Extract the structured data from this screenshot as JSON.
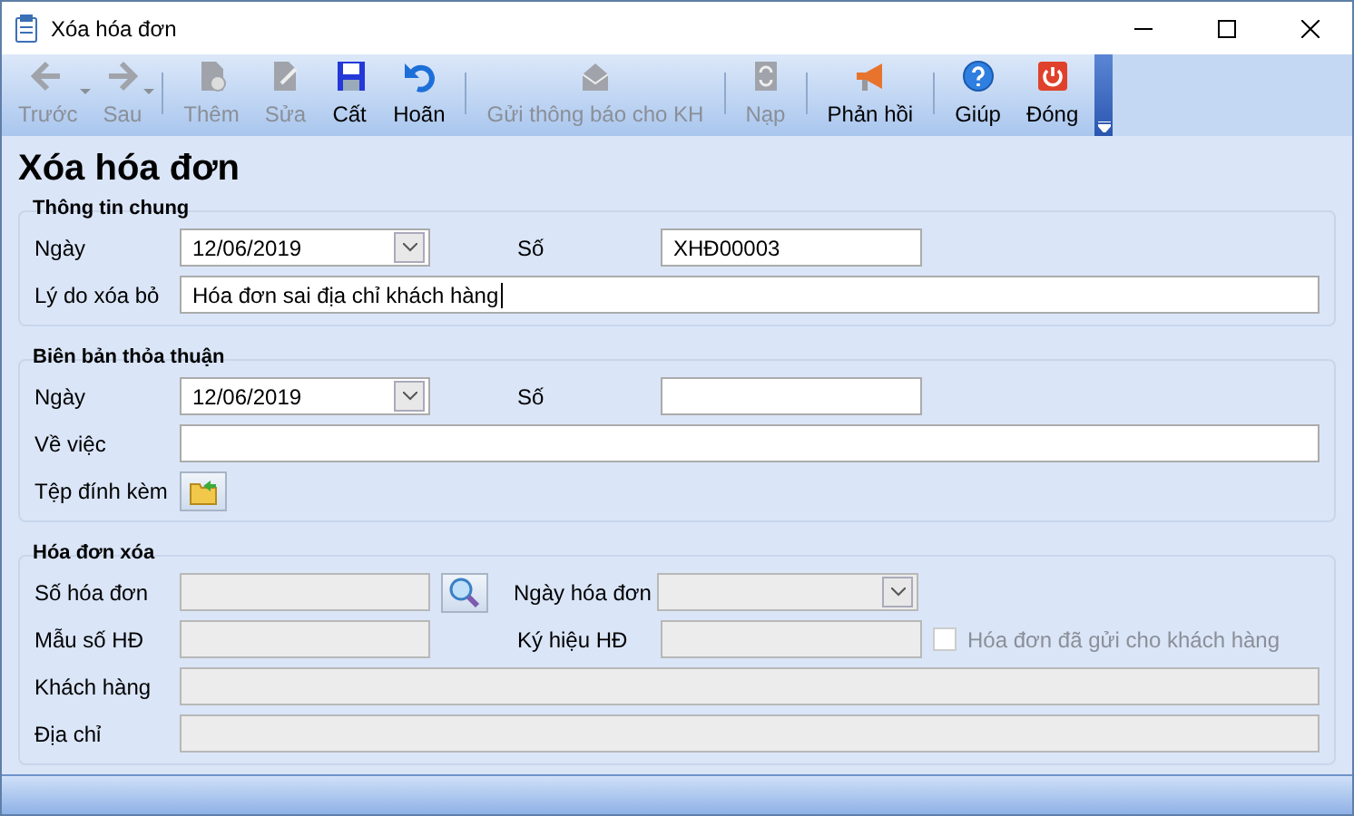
{
  "window": {
    "title": "Xóa hóa đơn"
  },
  "toolbar": [
    {
      "kind": "button",
      "label": "Trước",
      "disabled": true,
      "dropdown": true
    },
    {
      "kind": "button",
      "label": "Sau",
      "disabled": true,
      "dropdown": true
    },
    {
      "kind": "separator"
    },
    {
      "kind": "button",
      "label": "Thêm",
      "disabled": true
    },
    {
      "kind": "button",
      "label": "Sửa",
      "disabled": true
    },
    {
      "kind": "button",
      "label": "Cất",
      "disabled": false
    },
    {
      "kind": "button",
      "label": "Hoãn",
      "disabled": false
    },
    {
      "kind": "separator"
    },
    {
      "kind": "button",
      "label": "Gửi thông báo cho KH",
      "disabled": true
    },
    {
      "kind": "separator"
    },
    {
      "kind": "button",
      "label": "Nạp",
      "disabled": true
    },
    {
      "kind": "separator"
    },
    {
      "kind": "button",
      "label": "Phản hồi",
      "disabled": false
    },
    {
      "kind": "separator"
    },
    {
      "kind": "button",
      "label": "Giúp",
      "disabled": false
    },
    {
      "kind": "button",
      "label": "Đóng",
      "disabled": false
    }
  ],
  "heading": "Xóa hóa đơn",
  "sections": [
    {
      "title": "Thông tin chung",
      "rows": [
        [
          {
            "kind": "date",
            "label": "Ngày",
            "value": "12/06/2019"
          },
          {
            "kind": "text",
            "label": "Số",
            "value": "XHĐ00003"
          }
        ],
        [
          {
            "kind": "wide",
            "label": "Lý do xóa bỏ",
            "value": "Hóa đơn sai địa chỉ khách hàng"
          }
        ]
      ]
    },
    {
      "title": "Biên bản thỏa thuận",
      "rows": [
        [
          {
            "kind": "date",
            "label": "Ngày",
            "value": "12/06/2019"
          },
          {
            "kind": "text",
            "label": "Số"
          }
        ],
        [
          {
            "kind": "wide",
            "label": "Về việc"
          }
        ],
        [
          {
            "kind": "attach",
            "label": "Tệp đính kèm"
          }
        ]
      ]
    },
    {
      "title": "Hóa đơn xóa",
      "rows": [
        [
          {
            "kind": "search",
            "label": "Số hóa đơn",
            "disabled": true
          },
          {
            "kind": "date",
            "label": "Ngày hóa đơn",
            "disabled": true
          }
        ],
        [
          {
            "kind": "text",
            "label": "Mẫu số HĐ",
            "disabled": true
          },
          {
            "kind": "text",
            "label": "Ký hiệu HĐ",
            "disabled": true
          },
          {
            "kind": "checkbox",
            "label": "Hóa đơn đã gửi cho khách hàng",
            "checked": false,
            "disabled": true
          }
        ],
        [
          {
            "kind": "wide",
            "label": "Khách hàng",
            "disabled": true
          }
        ],
        [
          {
            "kind": "wide",
            "label": "Địa chỉ",
            "disabled": true
          }
        ]
      ]
    }
  ]
}
